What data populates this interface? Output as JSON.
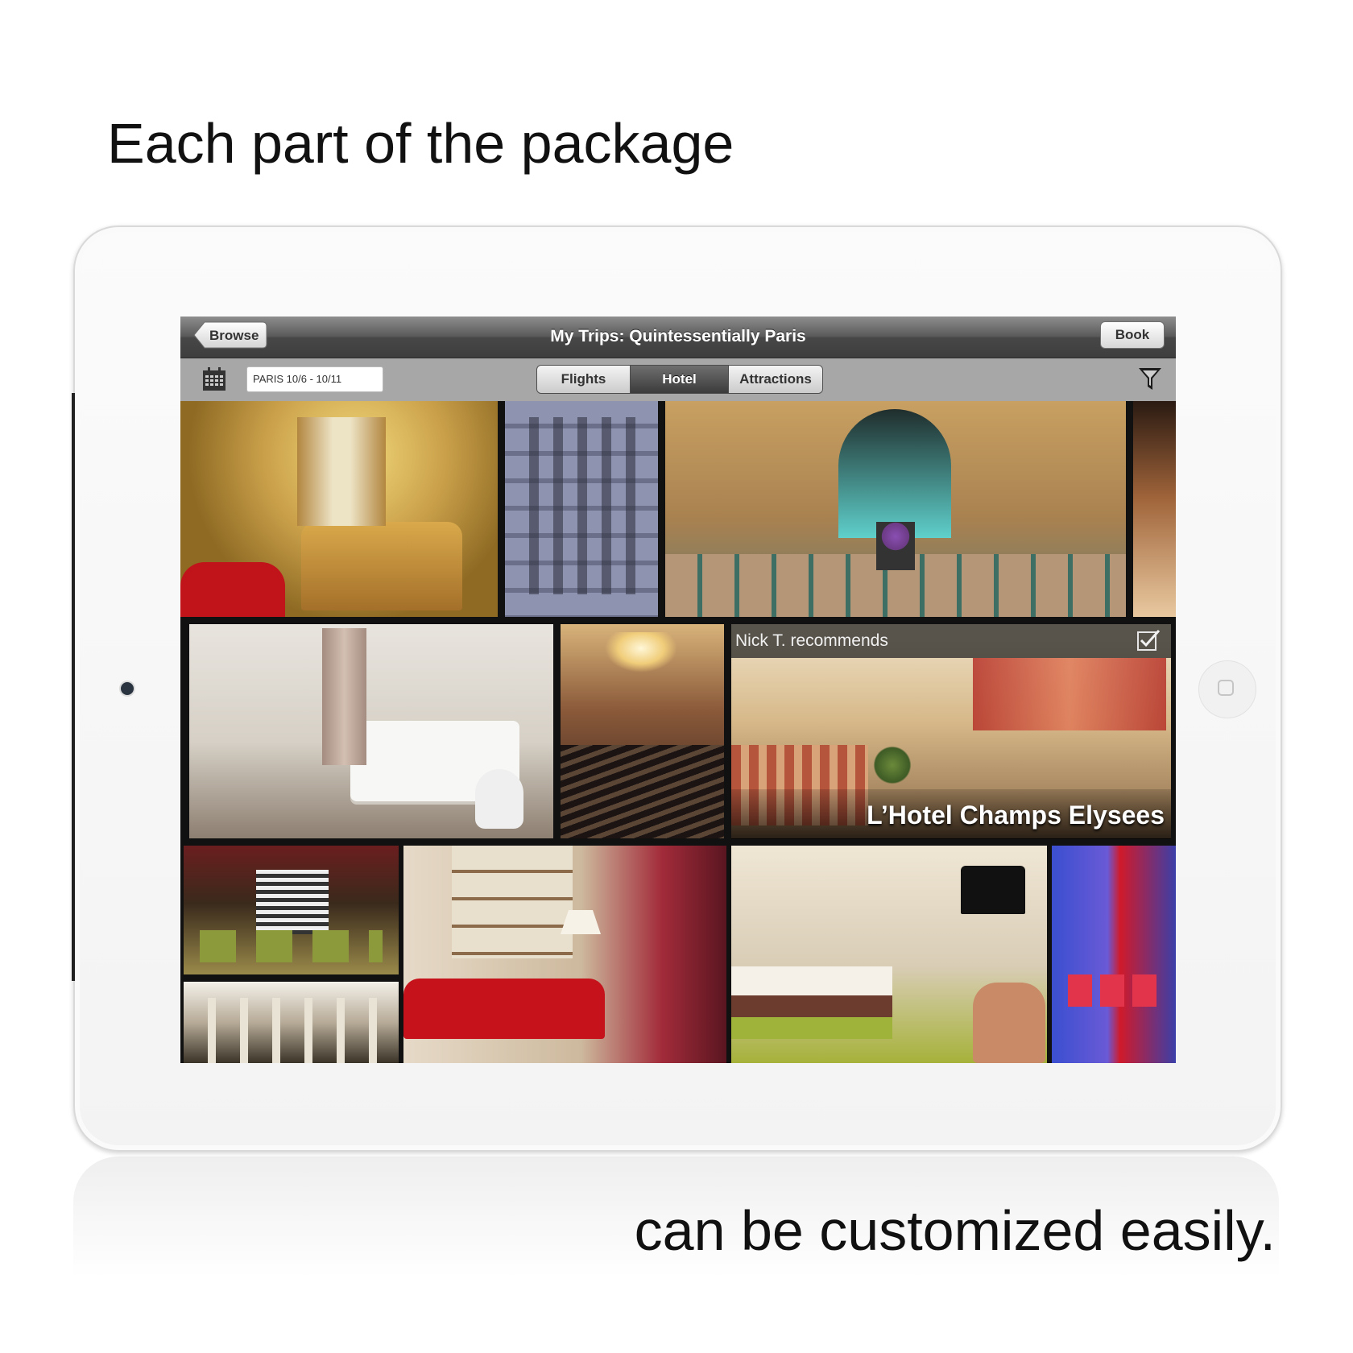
{
  "headline": "Each part of the package",
  "caption": "can be customized easily.",
  "navbar": {
    "title": "My Trips: Quintessentially Paris",
    "back_label": "Browse",
    "book_label": "Book"
  },
  "toolbar": {
    "date_value": "PARIS 10/6 - 10/11",
    "tabs": [
      {
        "label": "Flights",
        "active": false
      },
      {
        "label": "Hotel",
        "active": true
      },
      {
        "label": "Attractions",
        "active": false
      }
    ],
    "icons": [
      "calendar-icon",
      "filter-icon"
    ]
  },
  "featured": {
    "recommendation": "Nick T. recommends",
    "hotel_name": "L’Hotel Champs Elysees",
    "selected": true
  },
  "photos": [
    "ornate-bedroom-photo",
    "hotel-facade-photo",
    "grand-lobby-photo",
    "partial-room-photo",
    "modern-white-bedroom-photo",
    "staircase-atrium-photo",
    "featured-lounge-photo",
    "grand-stair-lounge-photo",
    "arcade-interior-photo",
    "red-sofa-lounge-photo",
    "boutique-bedroom-photo",
    "blue-red-lobby-photo"
  ]
}
